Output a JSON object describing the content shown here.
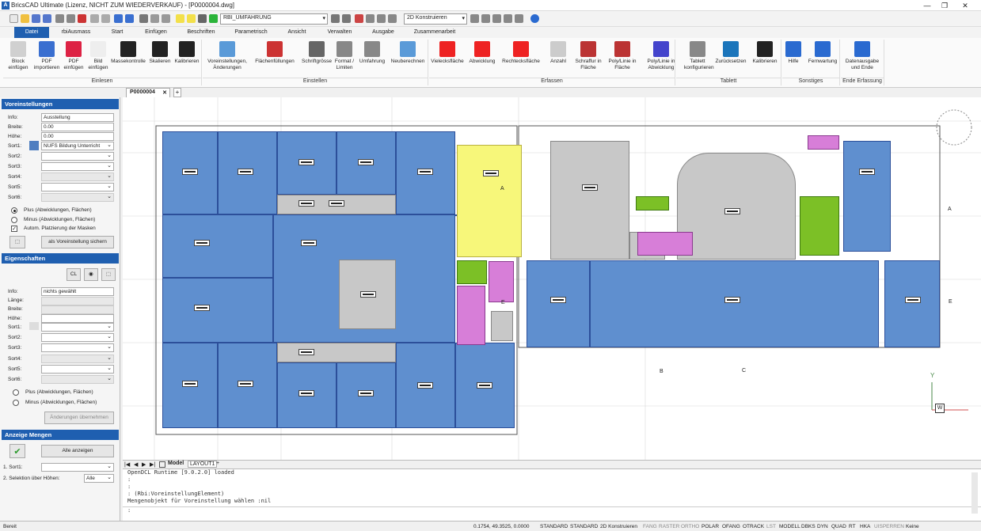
{
  "window": {
    "title": "BricsCAD Ultimate (Lizenz, NICHT ZUM WIEDERVERKAUF) - [P0000004.dwg]",
    "min": "—",
    "max": "❐",
    "close": "✕"
  },
  "qat": {
    "layer": "RBI_UMFAHRUNG",
    "workspace": "2D Konstruieren"
  },
  "tabs": [
    "Datei",
    "rbiAusmass",
    "Start",
    "Einfügen",
    "Beschriften",
    "Parametrisch",
    "Ansicht",
    "Verwalten",
    "Ausgabe",
    "Zusammenarbeit"
  ],
  "ribbon": {
    "buttons": [
      {
        "label": "Block einfügen",
        "icon": "block-icon"
      },
      {
        "label": "PDF importieren",
        "icon": "pdf-import-icon"
      },
      {
        "label": "PDF einfügen",
        "icon": "pdf-icon"
      },
      {
        "label": "Bild einfügen",
        "icon": "image-icon"
      },
      {
        "label": "Massekontrolle",
        "icon": "question-icon"
      },
      {
        "label": "Skalieren",
        "icon": "scale-icon"
      },
      {
        "label": "Kalibrieren",
        "icon": "calibrate-icon"
      },
      {
        "label": "Voreinstellungen, Änderungen",
        "icon": "gear-icon"
      },
      {
        "label": "Flächenfüllungen",
        "icon": "hatch-icon"
      },
      {
        "label": "Schriftgrösse",
        "icon": "text-size-icon"
      },
      {
        "label": "Format / Limiten",
        "icon": "format-icon"
      },
      {
        "label": "Umfahrung",
        "icon": "outline-icon"
      },
      {
        "label": "Neuberechnen",
        "icon": "refresh-icon"
      },
      {
        "label": "Vielecksfläche",
        "icon": "polygon-icon"
      },
      {
        "label": "Abwicklung",
        "icon": "unfold-icon"
      },
      {
        "label": "Rechtecksfläche",
        "icon": "rectangle-icon"
      },
      {
        "label": "Anzahl",
        "icon": "count-icon"
      },
      {
        "label": "Schraffur in Fläche",
        "icon": "hatch-area-icon"
      },
      {
        "label": "Poly/Linie in Fläche",
        "icon": "polyline-area-icon"
      },
      {
        "label": "Poly/Linie in Abwicklung",
        "icon": "polyline-unfold-icon"
      },
      {
        "label": "Tablett konfigurieren",
        "icon": "tablet-config-icon"
      },
      {
        "label": "Zurücksetzen",
        "icon": "undo-icon"
      },
      {
        "label": "Kalibrieren",
        "icon": "calibrate-icon"
      },
      {
        "label": "Hilfe",
        "icon": "help-icon"
      },
      {
        "label": "Fernwartung",
        "icon": "remote-icon"
      },
      {
        "label": "Datenausgabe und Ende",
        "icon": "export-icon"
      }
    ],
    "groups": [
      "Einlesen",
      "Einstellen",
      "Erfassen",
      "Tablett",
      "Sonstiges",
      "Ende Erfassung"
    ]
  },
  "doc_tab": "P0000004",
  "voreinstellungen": {
    "title": "Voreinstellungen",
    "labels": [
      "Info:",
      "Breite:",
      "Höhe:",
      "Sort1:",
      "Sort2:",
      "Sort3:",
      "Sort4:",
      "Sort5:",
      "Sort6:"
    ],
    "info": "Ausstellung",
    "breite": "0.00",
    "hoehe": "0.00",
    "sort1": "NUFS Bildung Unterricht",
    "plus": "Plus (Abwicklungen, Flächen)",
    "minus": "Minus (Abwicklungen, Flächen)",
    "autom": "Autom. Platzierung der Masken",
    "save": "als Voreinstellung sichern",
    "check": "✓"
  },
  "eigenschaften": {
    "title": "Eigenschaften",
    "labels": [
      "Info:",
      "Länge:",
      "Breite:",
      "Höhe:",
      "Sort1:",
      "Sort2:",
      "Sort3:",
      "Sort4:",
      "Sort5:",
      "Sort6:"
    ],
    "info": "nichts gewählt",
    "cl": "CL",
    "plus": "Plus (Abwicklungen, Flächen)",
    "minus": "Minus (Abwicklungen, Flächen)",
    "apply": "Änderungen übernehmen"
  },
  "anzeige": {
    "title": "Anzeige Mengen",
    "show_all": "Alle anzeigen",
    "sort1": "1. Sort1:",
    "sel": "2. Selektion über Höhen:",
    "sel_val": "Alle",
    "ok": "✔"
  },
  "layout_tabs": [
    "Model",
    "LAYOUT1"
  ],
  "command": [
    "OpenDCL Runtime [9.0.2.0] loaded",
    ":",
    ":",
    ": (Rbi:VoreinstellungElement)",
    "Mengenobjekt für Voreinstellung wählen :nil",
    ":"
  ],
  "status": {
    "left": "Bereit",
    "coords": "0.1754, 49.3525, 0.0000",
    "items": [
      {
        "t": "STANDARD",
        "on": true
      },
      {
        "t": "STANDARD",
        "on": true
      },
      {
        "t": "2D Konstruieren",
        "on": true
      },
      {
        "t": "FANG",
        "on": false
      },
      {
        "t": "RASTER",
        "on": false
      },
      {
        "t": "ORTHO",
        "on": false
      },
      {
        "t": "POLAR",
        "on": true
      },
      {
        "t": "OFANG",
        "on": true
      },
      {
        "t": "OTRACK",
        "on": true
      },
      {
        "t": "LST",
        "on": false
      },
      {
        "t": "MODELL",
        "on": true
      },
      {
        "t": "DBKS",
        "on": true
      },
      {
        "t": "DYN",
        "on": true
      },
      {
        "t": "QUAD",
        "on": true
      },
      {
        "t": "RT",
        "on": true
      },
      {
        "t": "HKA",
        "on": true
      },
      {
        "t": "UISPERREN",
        "on": false
      },
      {
        "t": "Keine",
        "on": true
      }
    ]
  },
  "ucs": {
    "y": "Y",
    "w": "W",
    "a1": "A",
    "a2": "A",
    "b": "B",
    "c": "C",
    "e1": "E",
    "e2": "E"
  }
}
